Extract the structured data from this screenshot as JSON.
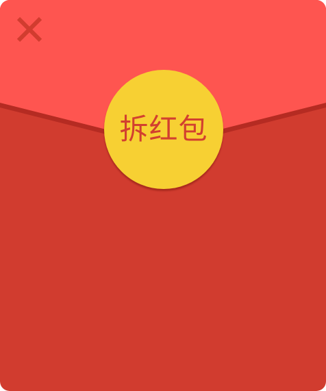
{
  "envelope": {
    "open_label": "拆红包",
    "close_icon": "close-icon"
  },
  "colors": {
    "flap": "#fe5550",
    "body": "#d13c2f",
    "seam_shadow": "#b52b22",
    "button": "#f7d033",
    "label": "#d2402f",
    "close_icon": "#d13c2f"
  }
}
